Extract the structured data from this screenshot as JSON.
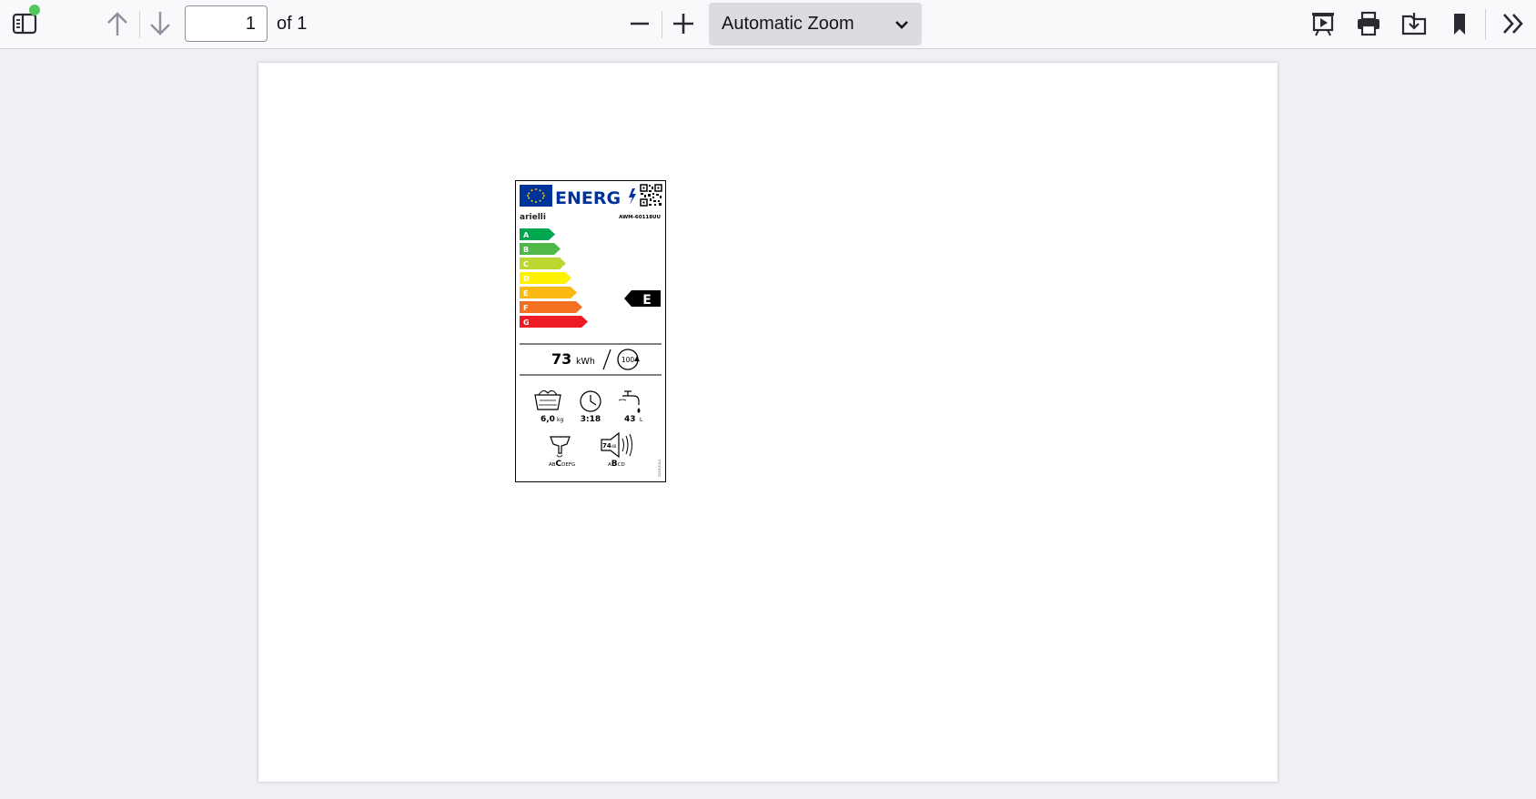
{
  "toolbar": {
    "page_number": "1",
    "page_count": "of 1",
    "zoom_label": "Automatic Zoom",
    "icons": [
      "sidebar-icon",
      "arrow-up-icon",
      "arrow-down-icon",
      "minus-icon",
      "plus-icon",
      "chevron-down-icon",
      "presentation-icon",
      "print-icon",
      "save-icon",
      "bookmark-icon",
      "double-chevron-right-icon"
    ],
    "notification_color": "#54c75a"
  },
  "energy_label": {
    "header": "ENERG",
    "brand": "arielli",
    "model": "AWM-60118UU",
    "classes": [
      "A",
      "B",
      "C",
      "D",
      "E",
      "F",
      "G"
    ],
    "class_colors": [
      "#00a650",
      "#50b848",
      "#bdd630",
      "#fff200",
      "#fdb913",
      "#f37021",
      "#ed1c24"
    ],
    "rating": "E",
    "energy_value": "73",
    "energy_unit": "kWh",
    "cycles": "100",
    "capacity_value": "6,0",
    "capacity_unit": "kg",
    "duration": "3:18",
    "water_value": "43",
    "water_unit": "L",
    "spin_scale_pre": "AB",
    "spin_scale_sel": "C",
    "spin_scale_post": "DEFG",
    "noise_value": "74",
    "noise_unit": "dB",
    "noise_scale_pre": "A",
    "noise_scale_sel": "B",
    "noise_scale_post": "CD",
    "regulation": "2019/2014"
  }
}
